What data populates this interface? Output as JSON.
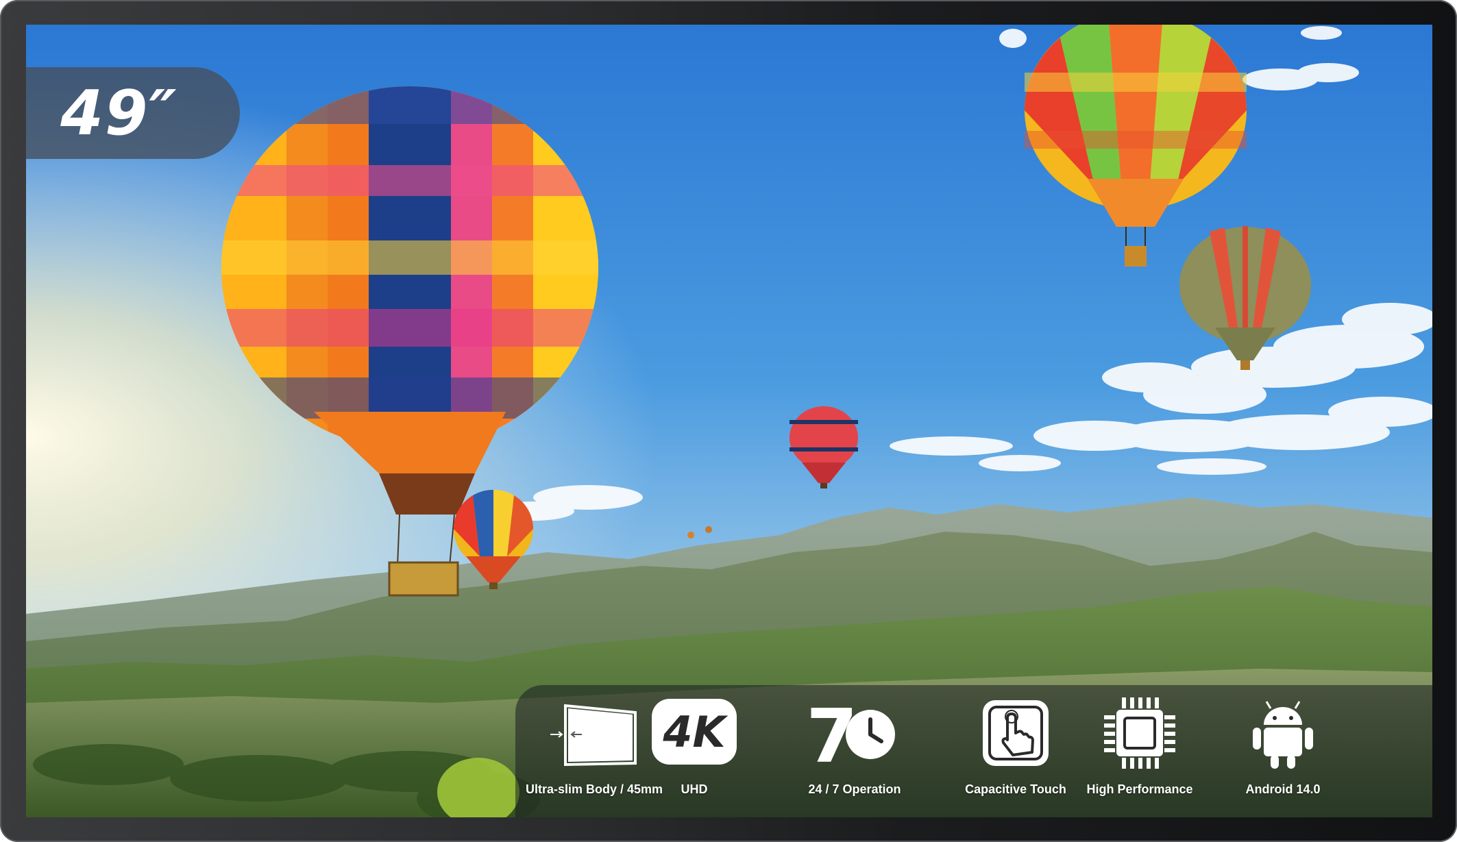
{
  "product": {
    "screen_size": "49″"
  },
  "features": [
    {
      "label": "Ultra-slim Body / 45mm",
      "icon": "ultra-slim-icon"
    },
    {
      "label": "UHD",
      "icon": "4k-icon",
      "icon_text": "4K"
    },
    {
      "label": "24 / 7 Operation",
      "icon": "clock-24-7-icon",
      "icon_text": "7"
    },
    {
      "label": "Capacitive Touch",
      "icon": "touch-hand-icon"
    },
    {
      "label": "High Performance",
      "icon": "processor-chip-icon"
    },
    {
      "label": "Android 14.0",
      "icon": "android-icon"
    }
  ],
  "colors": {
    "bezel": "#2a2b2d",
    "badge_bg": "#465262",
    "sky_top": "#2f7fd6",
    "sky_bottom": "#cfe6f2",
    "mountains": "#6e8c62"
  }
}
